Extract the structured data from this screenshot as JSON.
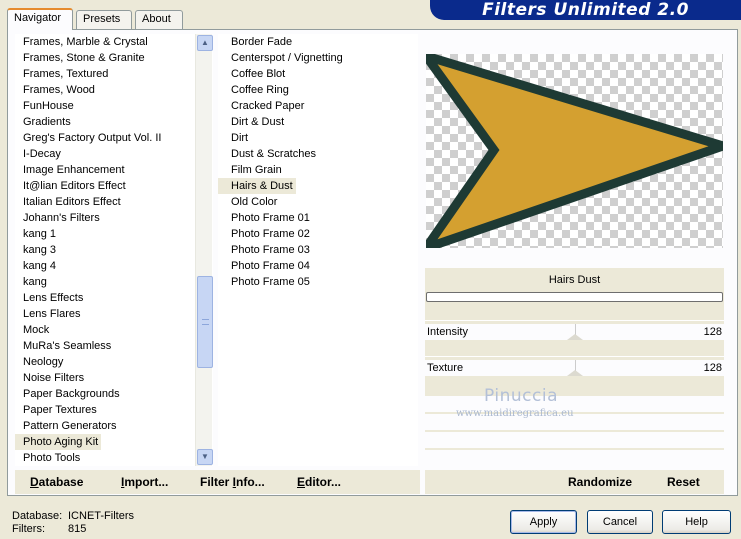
{
  "window": {
    "banner_title": "Filters Unlimited 2.0"
  },
  "tabs": [
    {
      "label": "Navigator",
      "active": true
    },
    {
      "label": "Presets",
      "active": false
    },
    {
      "label": "About",
      "active": false
    }
  ],
  "categories": {
    "items": [
      "Frames, Marble & Crystal",
      "Frames, Stone & Granite",
      "Frames, Textured",
      "Frames, Wood",
      "FunHouse",
      "Gradients",
      "Greg's Factory Output Vol. II",
      "I-Decay",
      "Image Enhancement",
      "It@lian Editors Effect",
      "Italian Editors Effect",
      "Johann's Filters",
      "kang 1",
      "kang 3",
      "kang 4",
      "kang",
      "Lens Effects",
      "Lens Flares",
      "Mock",
      "MuRa's Seamless",
      "Neology",
      "Noise Filters",
      "Paper Backgrounds",
      "Paper Textures",
      "Pattern Generators",
      "Photo Aging Kit",
      "Photo Tools"
    ],
    "selected_index": 25,
    "scroll_up_icon": "arrow-up-icon",
    "scroll_down_icon": "arrow-down-icon"
  },
  "filters": {
    "items": [
      "Border Fade",
      "Centerspot / Vignetting",
      "Coffee Blot",
      "Coffee Ring",
      "Cracked Paper",
      "Dirt & Dust",
      "Dirt",
      "Dust & Scratches",
      "Film Grain",
      "Hairs & Dust",
      "Old Color",
      "Photo Frame 01",
      "Photo Frame 02",
      "Photo Frame 03",
      "Photo Frame 04",
      "Photo Frame 05"
    ],
    "selected_index": 9
  },
  "preview": {
    "shape_fill": "#d4a030",
    "shape_border": "#1e3a34"
  },
  "controls": {
    "filter_title": "Hairs  Dust",
    "progress": 0,
    "sliders": [
      {
        "label": "Intensity",
        "value": "128",
        "fraction": 0.502
      },
      {
        "label": "Texture",
        "value": "128",
        "fraction": 0.502
      }
    ]
  },
  "watermark": {
    "title": "Pinuccia",
    "url": "www.maidiregrafica.eu"
  },
  "toolbar": {
    "database": {
      "u": "D",
      "rest": "atabase"
    },
    "import": {
      "u": "I",
      "rest": "mport..."
    },
    "filter_info": {
      "pre": "Filter ",
      "u": "I",
      "rest": "nfo..."
    },
    "editor": {
      "u": "E",
      "rest": "ditor..."
    },
    "randomize": "Randomize",
    "reset": "Reset"
  },
  "status": {
    "database_label": "Database:",
    "database_value": "ICNET-Filters",
    "filters_label": "Filters:",
    "filters_value": "815"
  },
  "buttons": {
    "apply": "Apply",
    "cancel": "Cancel",
    "help": "Help"
  }
}
